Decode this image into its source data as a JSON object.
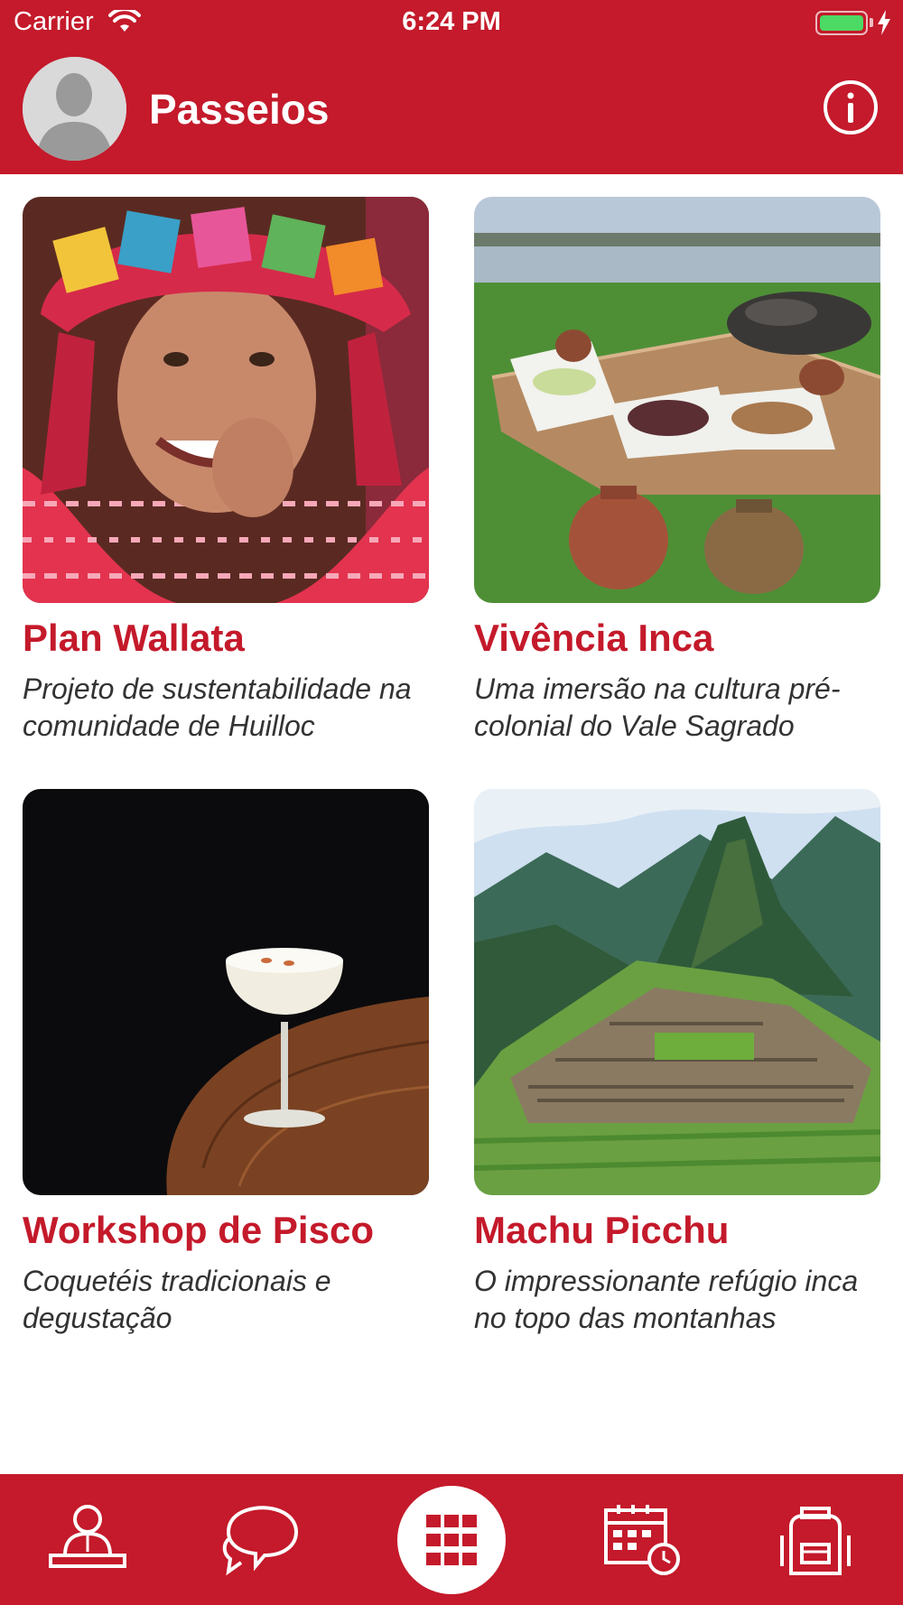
{
  "status_bar": {
    "carrier": "Carrier",
    "time": "6:24 PM"
  },
  "header": {
    "title": "Passeios",
    "avatar_icon": "user-silhouette-icon",
    "info_icon": "info-icon"
  },
  "colors": {
    "brand": "#C41A2B",
    "battery": "#4CD964"
  },
  "cards": [
    {
      "title": "Plan Wallata",
      "subtitle": "Projeto de sustentabilidade na comunidade de Huilloc"
    },
    {
      "title": "Vivência Inca",
      "subtitle": "Uma imersão na cultura pré-colonial do Vale Sagrado"
    },
    {
      "title": "Workshop de Pisco",
      "subtitle": "Coquetéis tradicionais e degustação"
    },
    {
      "title": "Machu Picchu",
      "subtitle": "O impressionante refúgio inca no topo das montanhas"
    }
  ],
  "tabbar": {
    "items": [
      {
        "icon": "person-desk-icon"
      },
      {
        "icon": "chat-bubbles-icon"
      },
      {
        "icon": "grid-icon",
        "selected": true
      },
      {
        "icon": "calendar-clock-icon"
      },
      {
        "icon": "backpack-icon"
      }
    ]
  }
}
